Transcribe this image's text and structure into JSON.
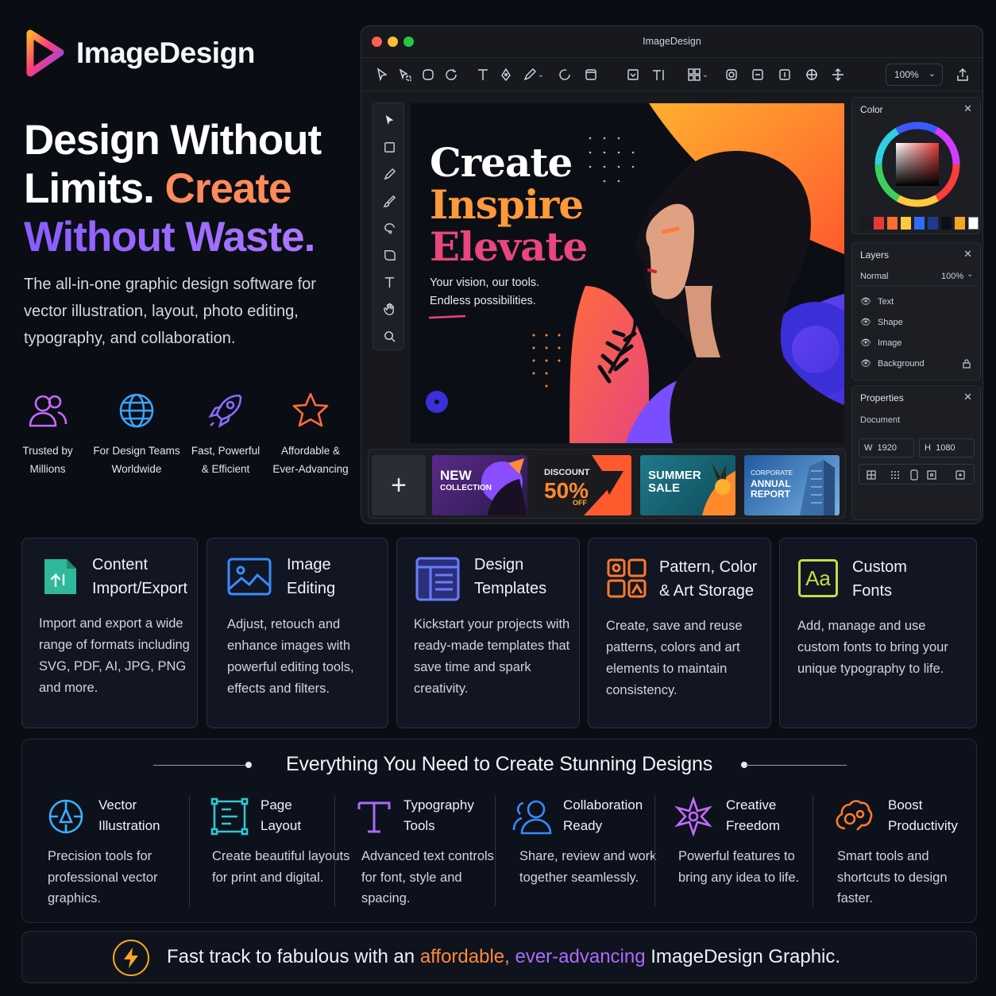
{
  "brand": {
    "name": "ImageDesign"
  },
  "hero": {
    "title_line1": "Design Without",
    "title_line2a": "Limits.",
    "title_line2b": "Create",
    "title_line3": "Without Waste.",
    "description": "The all-in-one graphic design software for vector illustration, layout, photo editing, typography, and collaboration."
  },
  "badges": [
    {
      "icon": "users-icon",
      "line1": "Trusted by",
      "line2": "Millions"
    },
    {
      "icon": "globe-icon",
      "line1": "For Design Teams",
      "line2": "Worldwide"
    },
    {
      "icon": "rocket-icon",
      "line1": "Fast, Powerful",
      "line2": "& Efficient"
    },
    {
      "icon": "star-icon",
      "line1": "Affordable &",
      "line2": "Ever-Advancing"
    }
  ],
  "app": {
    "title": "ImageDesign",
    "zoom": "100%",
    "canvas": {
      "line1": "Create",
      "line2": "Inspire",
      "line3": "Elevate",
      "sub1": "Your vision, our tools.",
      "sub2": "Endless possibilities."
    },
    "thumbnails": [
      {
        "l1": "NEW",
        "l2": "COLLECTION"
      },
      {
        "l1": "DISCOUNT",
        "l2": "50%",
        "l3": "OFF"
      },
      {
        "l1": "SUMMER",
        "l2": "SALE"
      },
      {
        "l1": "CORPORATE",
        "l2": "ANNUAL",
        "l3": "REPORT"
      }
    ],
    "color_panel": {
      "title": "Color",
      "swatches": [
        "#1a1a1f",
        "#e53935",
        "#ff6d2d",
        "#ffc93c",
        "#2f6df6",
        "#1d3b8f",
        "#0c0f1a",
        "#f5a623",
        "#ffffff"
      ]
    },
    "layers_panel": {
      "title": "Layers",
      "blend": "Normal",
      "opacity": "100%",
      "items": [
        "Text",
        "Shape",
        "Image",
        "Background"
      ]
    },
    "properties_panel": {
      "title": "Properties",
      "section": "Document",
      "w_label": "W",
      "w_value": "1920",
      "h_label": "H",
      "h_value": "1080"
    }
  },
  "cards": [
    {
      "title1": "Content",
      "title2": "Import/Export",
      "desc": "Import and export a wide range of formats including SVG, PDF, AI, JPG, PNG and more."
    },
    {
      "title1": "Image",
      "title2": "Editing",
      "desc": "Adjust, retouch and enhance images with powerful editing tools, effects and filters."
    },
    {
      "title1": "Design",
      "title2": "Templates",
      "desc": "Kickstart your projects with ready-made templates that save time and spark creativity."
    },
    {
      "title1": "Pattern, Color",
      "title2": "& Art Storage",
      "desc": "Create, save and reuse patterns, colors and art elements to maintain consistency."
    },
    {
      "title1": "Custom",
      "title2": "Fonts",
      "icon_text": "Aa",
      "desc": "Add, manage and use custom fonts to bring your unique typography to life."
    }
  ],
  "everything": {
    "title": "Everything You Need to Create Stunning Designs",
    "items": [
      {
        "t1": "Vector",
        "t2": "Illustration",
        "desc": "Precision tools for professional vector graphics."
      },
      {
        "t1": "Page",
        "t2": "Layout",
        "desc": "Create beautiful layouts for print and digital."
      },
      {
        "t1": "Typography",
        "t2": "Tools",
        "desc": "Advanced text controls for font, style and spacing."
      },
      {
        "t1": "Collaboration",
        "t2": "Ready",
        "desc": "Share, review and work together seamlessly."
      },
      {
        "t1": "Creative",
        "t2": "Freedom",
        "desc": "Powerful features to bring any idea to life."
      },
      {
        "t1": "Boost",
        "t2": "Productivity",
        "desc": "Smart tools and shortcuts to design faster."
      }
    ]
  },
  "footer": {
    "pre": "Fast track to fabulous with an ",
    "orange": "affordable,",
    "purple": "ever-advancing",
    "post": " ImageDesign Graphic."
  }
}
